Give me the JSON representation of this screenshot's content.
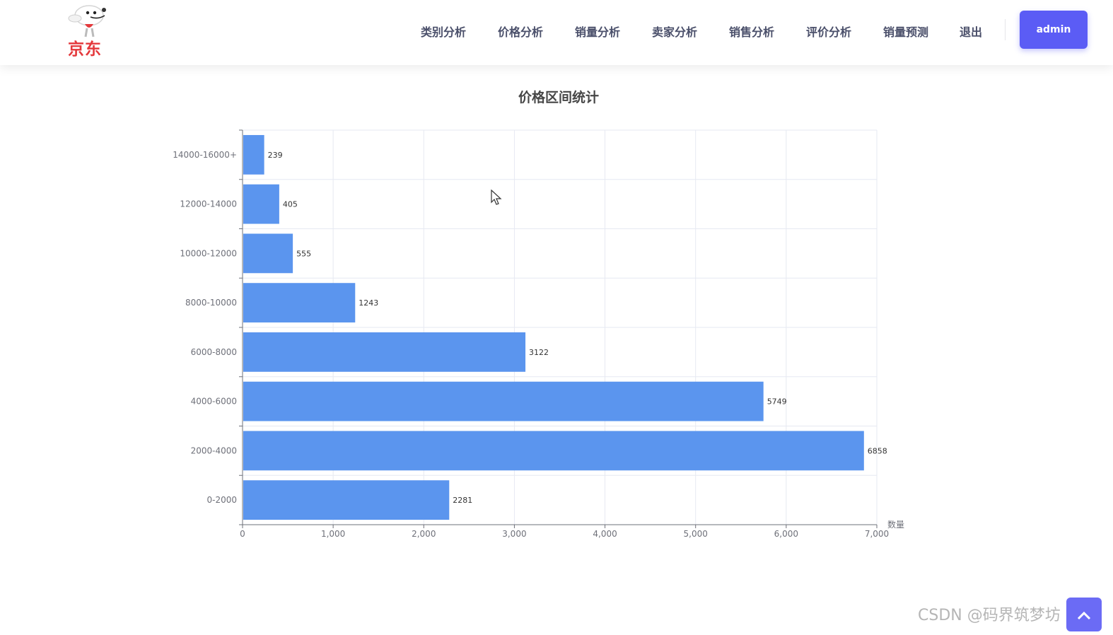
{
  "brand": {
    "name": "京东"
  },
  "nav": {
    "items": [
      {
        "label": "类别分析"
      },
      {
        "label": "价格分析"
      },
      {
        "label": "销量分析"
      },
      {
        "label": "卖家分析"
      },
      {
        "label": "销售分析"
      },
      {
        "label": "评价分析"
      },
      {
        "label": "销量预测"
      },
      {
        "label": "退出"
      }
    ],
    "user_button": "admin"
  },
  "chart_data": {
    "type": "bar",
    "orientation": "horizontal",
    "title": "价格区间统计",
    "xlabel": "数量",
    "ylabel": "",
    "categories": [
      "0-2000",
      "2000-4000",
      "4000-6000",
      "6000-8000",
      "8000-10000",
      "10000-12000",
      "12000-14000",
      "14000-16000+"
    ],
    "values": [
      2281,
      6858,
      5749,
      3122,
      1243,
      555,
      405,
      239
    ],
    "xlim": [
      0,
      7000
    ],
    "xticks": [
      0,
      1000,
      2000,
      3000,
      4000,
      5000,
      6000,
      7000
    ],
    "xtick_labels": [
      "0",
      "1,000",
      "2,000",
      "3,000",
      "4,000",
      "5,000",
      "6,000",
      "7,000"
    ],
    "grid": true,
    "bar_color": "#5b95ee",
    "data_labels": true
  },
  "watermark": "CSDN @码界筑梦坊"
}
